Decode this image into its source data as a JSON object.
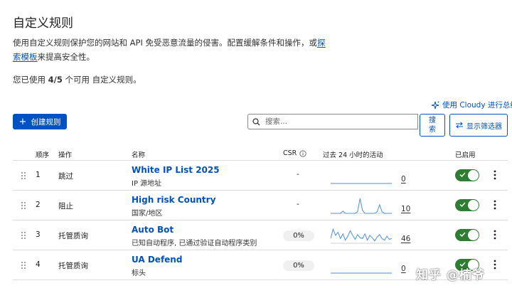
{
  "page": {
    "title": "自定义规则",
    "description_prefix": "使用自定义规则保护您的网站和 API 免受恶意流量的侵害。配置缓解条件和操作，或",
    "description_link": "探索模板",
    "description_suffix": "来提高安全性。",
    "usage_prefix": "您已使用 ",
    "usage_count": "4/5",
    "usage_suffix": " 个可用 自定义规则。"
  },
  "toolbar": {
    "cloudy_label": "使用 Cloudy 进行总结",
    "create_label": "创建规则",
    "search_placeholder": "搜索...",
    "search_button": "搜索",
    "filter_button": "显示筛选器"
  },
  "table": {
    "headers": {
      "order": "顺序",
      "action": "操作",
      "name": "名称",
      "csr": "CSR",
      "activity": "过去 24 小时的活动",
      "enabled": "已启用"
    },
    "rows": [
      {
        "order": "1",
        "action": "跳过",
        "name": "White IP List 2025",
        "subtitle": "IP 源地址",
        "csr": "-",
        "count": "0",
        "enabled": true,
        "spark": [
          0,
          0,
          0,
          0,
          0,
          0,
          0,
          0,
          0,
          0,
          0,
          0
        ]
      },
      {
        "order": "2",
        "action": "阻止",
        "name": "High risk Country",
        "subtitle": "国家/地区",
        "csr": "-",
        "count": "10",
        "enabled": true,
        "spark": [
          0,
          0,
          0,
          0,
          0,
          0.15,
          0,
          0,
          0,
          0,
          0,
          0.1,
          0.95,
          0.2,
          0,
          0,
          0,
          0,
          0,
          0.1,
          0.55,
          0.1,
          0,
          0,
          0,
          0
        ]
      },
      {
        "order": "3",
        "action": "托管质询",
        "name": "Auto Bot",
        "subtitle": "已知自动程序, 已通过验证自动程序类别",
        "csr": "0%",
        "count": "46",
        "enabled": true,
        "spark": [
          0.3,
          0.9,
          0.5,
          0.7,
          0.3,
          0.6,
          0.2,
          0.45,
          0.8,
          0.5,
          0.25,
          0.55,
          0.35,
          0.3,
          0.6,
          0.2,
          0.5,
          0.35,
          0.15,
          0.4,
          0.55,
          0.3,
          0.2,
          0.45,
          0.25,
          0.3
        ]
      },
      {
        "order": "4",
        "action": "托管质询",
        "name": "UA Defend",
        "subtitle": "标头",
        "csr": "0%",
        "count": "0",
        "enabled": true,
        "spark": [
          0,
          0,
          0,
          0,
          0,
          0,
          0,
          0,
          0,
          0,
          0,
          0
        ]
      }
    ]
  },
  "watermark": "知乎 @楠爷",
  "colors": {
    "accent": "#0051c3",
    "toggle_on": "#2e7d32",
    "spark": "#4a90e2"
  }
}
